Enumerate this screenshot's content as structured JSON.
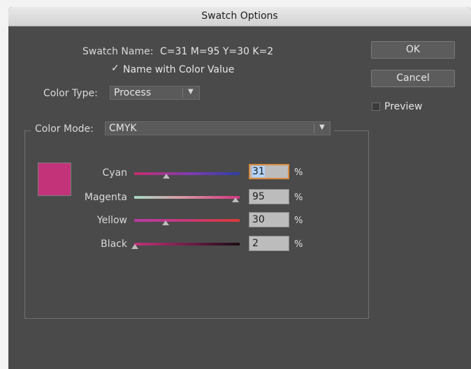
{
  "title": "Swatch Options",
  "swatch_name_label": "Swatch Name:",
  "swatch_name_value": "C=31 M=95 Y=30 K=2",
  "name_with_color_value_label": "Name with Color Value",
  "name_with_color_value_checked": true,
  "color_type_label": "Color Type:",
  "color_type_value": "Process",
  "color_mode_label": "Color Mode:",
  "color_mode_value": "CMYK",
  "buttons": {
    "ok": "OK",
    "cancel": "Cancel"
  },
  "preview_label": "Preview",
  "preview_checked": false,
  "swatch_color": "#c2337a",
  "channels": [
    {
      "name": "Cyan",
      "value": "31",
      "unit": "%"
    },
    {
      "name": "Magenta",
      "value": "95",
      "unit": "%"
    },
    {
      "name": "Yellow",
      "value": "30",
      "unit": "%"
    },
    {
      "name": "Black",
      "value": "2",
      "unit": "%"
    }
  ]
}
